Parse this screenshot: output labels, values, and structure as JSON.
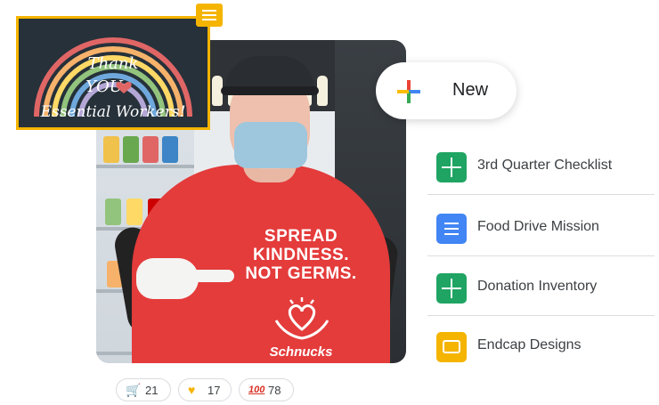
{
  "sticker": {
    "lines": [
      "Thank",
      "YOU",
      "Essential Workers!"
    ]
  },
  "photo": {
    "shirt_text": [
      "SPREAD",
      "KINDNESS.",
      "NOT GERMS."
    ],
    "brand": "Schnucks"
  },
  "new_button": {
    "label": "New",
    "icon": "plus-icon"
  },
  "files": [
    {
      "name": "3rd Quarter Checklist",
      "type": "sheets",
      "icon": "sheets-icon",
      "color": "#1fa463"
    },
    {
      "name": "Food Drive Mission",
      "type": "docs",
      "icon": "docs-icon",
      "color": "#4285f4"
    },
    {
      "name": "Donation Inventory",
      "type": "sheets",
      "icon": "sheets-icon",
      "color": "#1fa463"
    },
    {
      "name": "Endcap Designs",
      "type": "slides",
      "icon": "slides-icon",
      "color": "#f4b400"
    }
  ],
  "reactions": [
    {
      "emoji": "shopping-cart-icon",
      "count": "21"
    },
    {
      "emoji": "yellow-heart-icon",
      "count": "17"
    },
    {
      "emoji": "hundred-points-icon",
      "count": "78"
    }
  ]
}
